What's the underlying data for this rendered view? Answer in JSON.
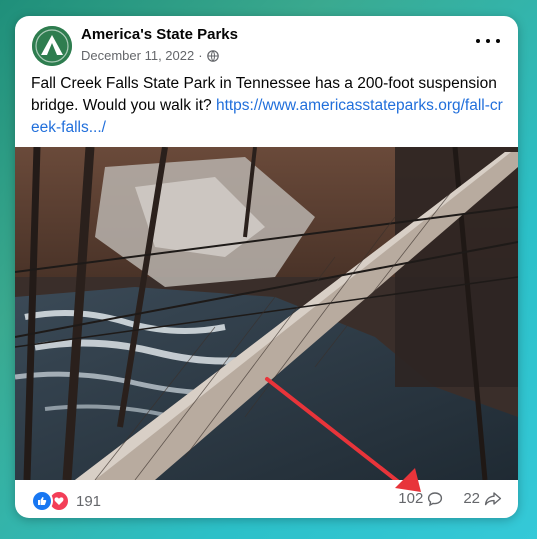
{
  "post": {
    "page_name": "America's State Parks",
    "date": "December 11, 2022",
    "separator": "·",
    "audience_icon": "globe-icon",
    "text": "Fall Creek Falls State Park in Tennessee has a 200-foot suspension bridge.  Would you walk it? ",
    "link": "https://www.americasstateparks.org/fall-creek-falls.../"
  },
  "footer": {
    "reaction_count": "191",
    "comment_count": "102",
    "share_count": "22"
  },
  "colors": {
    "link": "#216fdb",
    "like": "#1877f2",
    "love": "#f33e58",
    "annotation_arrow": "#e8343a",
    "avatar": "#2e7d4f"
  }
}
